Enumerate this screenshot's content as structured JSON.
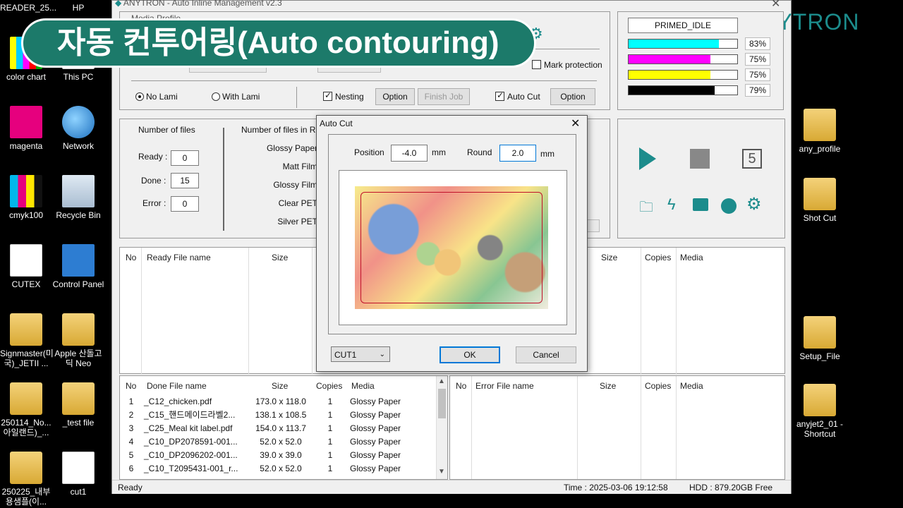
{
  "desktop_left": [
    {
      "label": "READER_25...",
      "icon": "document-icon"
    },
    {
      "label": "HP",
      "icon": "folder-icon"
    },
    {
      "label": "color chart",
      "icon": "color-chart-icon"
    },
    {
      "label": "This PC",
      "icon": "computer-icon"
    },
    {
      "label": "magenta",
      "icon": "image-icon"
    },
    {
      "label": "Network",
      "icon": "network-icon"
    },
    {
      "label": "cmyk100",
      "icon": "image-icon"
    },
    {
      "label": "Recycle Bin",
      "icon": "recycle-bin-icon"
    },
    {
      "label": "CUTEX",
      "icon": "document-icon"
    },
    {
      "label": "Control Panel",
      "icon": "control-panel-icon"
    },
    {
      "label": "Signmaster(미국)_JETII ...",
      "icon": "folder-icon"
    },
    {
      "label": "Apple 산돌고딕 Neo",
      "icon": "folder-icon"
    },
    {
      "label": "250114_No...아일랜드)_...",
      "icon": "folder-icon"
    },
    {
      "label": "_test file",
      "icon": "folder-icon"
    },
    {
      "label": "250225_내부용샘플(이...",
      "icon": "folder-icon"
    },
    {
      "label": "cut1",
      "icon": "document-icon"
    }
  ],
  "desktop_right": [
    {
      "label": "any_profile",
      "icon": "folder-icon"
    },
    {
      "label": "Shot Cut",
      "icon": "folder-icon"
    },
    {
      "label": "Setup_File",
      "icon": "folder-icon"
    },
    {
      "label": "anyjet2_01 - Shortcut",
      "icon": "folder-icon"
    }
  ],
  "banner": {
    "text": "자동 컨투어링(Auto contouring)"
  },
  "window": {
    "title": "ANYTRON - Auto Inline Management v2.3",
    "media_profile_label": "Media Profile",
    "brand": "ANYTRON"
  },
  "top_options": {
    "no_lami": "No Lami",
    "with_lami": "With Lami",
    "nesting": "Nesting",
    "nesting_option": "Option",
    "finish_job": "Finish Job",
    "auto_cut": "Auto Cut",
    "auto_cut_option": "Option",
    "mark_protection": "Mark protection"
  },
  "printer": {
    "status": "PRIMED_IDLE",
    "inks": [
      {
        "color": "#00ffff",
        "level": 0.83,
        "pct": "83%"
      },
      {
        "color": "#ff00ff",
        "level": 0.75,
        "pct": "75%"
      },
      {
        "color": "#ffff00",
        "level": 0.75,
        "pct": "75%"
      },
      {
        "color": "#000000",
        "level": 0.79,
        "pct": "79%"
      }
    ]
  },
  "counts": {
    "title": "Number of files",
    "ready_label": "Ready :",
    "ready": "0",
    "done_label": "Done :",
    "done": "15",
    "error_label": "Error :",
    "error": "0",
    "in_r_title": "Number of files in R",
    "media": [
      "Glossy Paper",
      "Matt Film",
      "Glossy Film",
      "Clear PET",
      "Silver PET"
    ]
  },
  "controls": {
    "counter": "5"
  },
  "ready_table": {
    "headers": [
      "No",
      "Ready File name",
      "Size",
      "C"
    ]
  },
  "right_top_table": {
    "headers": [
      "Size",
      "Copies",
      "Media"
    ]
  },
  "done_table": {
    "headers": [
      "No",
      "Done File name",
      "Size",
      "Copies",
      "Media"
    ],
    "rows": [
      [
        "1",
        "_C12_chicken.pdf",
        "173.0 x 118.0",
        "1",
        "Glossy Paper"
      ],
      [
        "2",
        "_C15_핸드메이드라벨2...",
        "138.1 x 108.5",
        "1",
        "Glossy Paper"
      ],
      [
        "3",
        "_C25_Meal kit label.pdf",
        "154.0 x 113.7",
        "1",
        "Glossy Paper"
      ],
      [
        "4",
        "_C10_DP2078591-001...",
        "52.0 x 52.0",
        "1",
        "Glossy Paper"
      ],
      [
        "5",
        "_C10_DP2096202-001...",
        "39.0 x 39.0",
        "1",
        "Glossy Paper"
      ],
      [
        "6",
        "_C10_T2095431-001_r...",
        "52.0 x 52.0",
        "1",
        "Glossy Paper"
      ]
    ]
  },
  "error_table": {
    "headers": [
      "No",
      "Error File name",
      "Size",
      "Copies",
      "Media"
    ]
  },
  "statusbar": {
    "state": "Ready",
    "time": "Time : 2025-03-06 19:12:58",
    "hdd": "HDD : 879.20GB Free"
  },
  "dialog": {
    "title": "Auto Cut",
    "position_label": "Position",
    "position_value": "-4.0",
    "position_unit": "mm",
    "round_label": "Round",
    "round_value": "2.0",
    "round_unit": "mm",
    "cut_select": "CUT1",
    "ok": "OK",
    "cancel": "Cancel"
  }
}
